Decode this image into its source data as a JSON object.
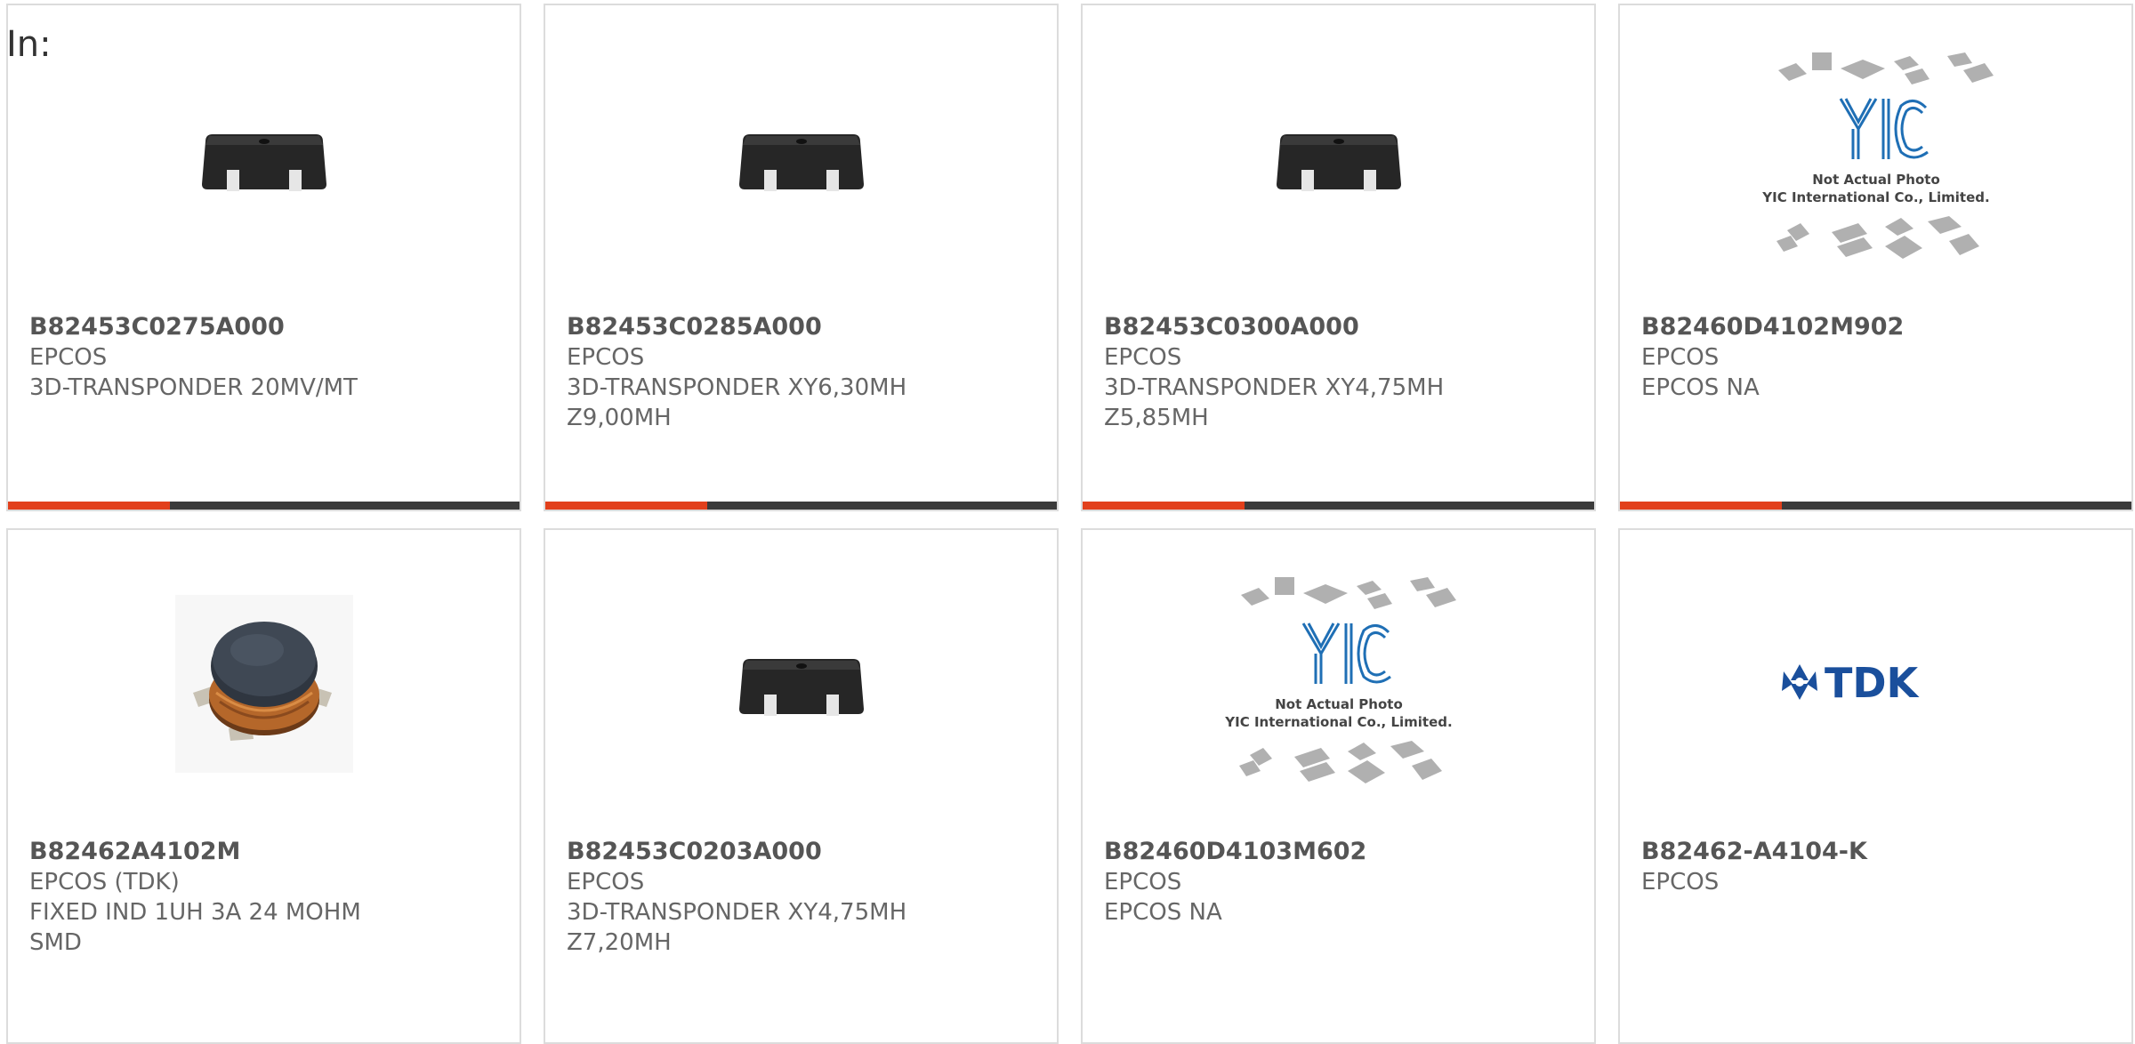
{
  "header": {
    "label": "In:"
  },
  "products": [
    {
      "part_number": "B82453C0275A000",
      "manufacturer": "EPCOS",
      "description": "3D-TRANSPONDER 20MV/MT",
      "image": "transponder-chip"
    },
    {
      "part_number": "B82453C0285A000",
      "manufacturer": "EPCOS",
      "description": "3D-TRANSPONDER XY6,30MH Z9,00MH",
      "image": "transponder-chip"
    },
    {
      "part_number": "B82453C0300A000",
      "manufacturer": "EPCOS",
      "description": "3D-TRANSPONDER XY4,75MH Z5,85MH",
      "image": "transponder-chip"
    },
    {
      "part_number": "B82460D4102M902",
      "manufacturer": "EPCOS",
      "description": "EPCOS NA",
      "image": "yic-placeholder",
      "placeholder_line1": "Not Actual Photo",
      "placeholder_line2": "YIC International Co., Limited.",
      "placeholder_logo": "YIC"
    },
    {
      "part_number": "B82462A4102M",
      "manufacturer": "EPCOS (TDK)",
      "description": "FIXED IND 1UH 3A 24 MOHM SMD",
      "image": "smd-inductor"
    },
    {
      "part_number": "B82453C0203A000",
      "manufacturer": "EPCOS",
      "description": "3D-TRANSPONDER XY4,75MH Z7,20MH",
      "image": "transponder-chip"
    },
    {
      "part_number": "B82460D4103M602",
      "manufacturer": "EPCOS",
      "description": "EPCOS NA",
      "image": "yic-placeholder",
      "placeholder_line1": "Not Actual Photo",
      "placeholder_line2": "YIC International Co., Limited.",
      "placeholder_logo": "YIC"
    },
    {
      "part_number": "B82462-A4104-K",
      "manufacturer": "EPCOS",
      "description": "",
      "image": "tdk-logo",
      "logo_text": "TDK"
    }
  ],
  "colors": {
    "accent": "#e2401c",
    "bar": "#3b3b3b",
    "yic_blue": "#1f6fb5",
    "tdk_blue": "#1a4f9c"
  }
}
